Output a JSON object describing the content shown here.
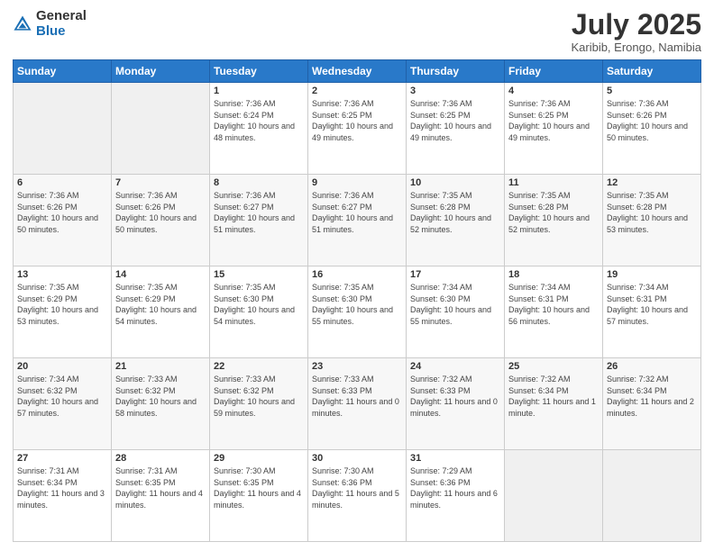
{
  "logo": {
    "general": "General",
    "blue": "Blue"
  },
  "title": "July 2025",
  "subtitle": "Karibib, Erongo, Namibia",
  "days_of_week": [
    "Sunday",
    "Monday",
    "Tuesday",
    "Wednesday",
    "Thursday",
    "Friday",
    "Saturday"
  ],
  "weeks": [
    [
      {
        "day": "",
        "info": ""
      },
      {
        "day": "",
        "info": ""
      },
      {
        "day": "1",
        "info": "Sunrise: 7:36 AM\nSunset: 6:24 PM\nDaylight: 10 hours and 48 minutes."
      },
      {
        "day": "2",
        "info": "Sunrise: 7:36 AM\nSunset: 6:25 PM\nDaylight: 10 hours and 49 minutes."
      },
      {
        "day": "3",
        "info": "Sunrise: 7:36 AM\nSunset: 6:25 PM\nDaylight: 10 hours and 49 minutes."
      },
      {
        "day": "4",
        "info": "Sunrise: 7:36 AM\nSunset: 6:25 PM\nDaylight: 10 hours and 49 minutes."
      },
      {
        "day": "5",
        "info": "Sunrise: 7:36 AM\nSunset: 6:26 PM\nDaylight: 10 hours and 50 minutes."
      }
    ],
    [
      {
        "day": "6",
        "info": "Sunrise: 7:36 AM\nSunset: 6:26 PM\nDaylight: 10 hours and 50 minutes."
      },
      {
        "day": "7",
        "info": "Sunrise: 7:36 AM\nSunset: 6:26 PM\nDaylight: 10 hours and 50 minutes."
      },
      {
        "day": "8",
        "info": "Sunrise: 7:36 AM\nSunset: 6:27 PM\nDaylight: 10 hours and 51 minutes."
      },
      {
        "day": "9",
        "info": "Sunrise: 7:36 AM\nSunset: 6:27 PM\nDaylight: 10 hours and 51 minutes."
      },
      {
        "day": "10",
        "info": "Sunrise: 7:35 AM\nSunset: 6:28 PM\nDaylight: 10 hours and 52 minutes."
      },
      {
        "day": "11",
        "info": "Sunrise: 7:35 AM\nSunset: 6:28 PM\nDaylight: 10 hours and 52 minutes."
      },
      {
        "day": "12",
        "info": "Sunrise: 7:35 AM\nSunset: 6:28 PM\nDaylight: 10 hours and 53 minutes."
      }
    ],
    [
      {
        "day": "13",
        "info": "Sunrise: 7:35 AM\nSunset: 6:29 PM\nDaylight: 10 hours and 53 minutes."
      },
      {
        "day": "14",
        "info": "Sunrise: 7:35 AM\nSunset: 6:29 PM\nDaylight: 10 hours and 54 minutes."
      },
      {
        "day": "15",
        "info": "Sunrise: 7:35 AM\nSunset: 6:30 PM\nDaylight: 10 hours and 54 minutes."
      },
      {
        "day": "16",
        "info": "Sunrise: 7:35 AM\nSunset: 6:30 PM\nDaylight: 10 hours and 55 minutes."
      },
      {
        "day": "17",
        "info": "Sunrise: 7:34 AM\nSunset: 6:30 PM\nDaylight: 10 hours and 55 minutes."
      },
      {
        "day": "18",
        "info": "Sunrise: 7:34 AM\nSunset: 6:31 PM\nDaylight: 10 hours and 56 minutes."
      },
      {
        "day": "19",
        "info": "Sunrise: 7:34 AM\nSunset: 6:31 PM\nDaylight: 10 hours and 57 minutes."
      }
    ],
    [
      {
        "day": "20",
        "info": "Sunrise: 7:34 AM\nSunset: 6:32 PM\nDaylight: 10 hours and 57 minutes."
      },
      {
        "day": "21",
        "info": "Sunrise: 7:33 AM\nSunset: 6:32 PM\nDaylight: 10 hours and 58 minutes."
      },
      {
        "day": "22",
        "info": "Sunrise: 7:33 AM\nSunset: 6:32 PM\nDaylight: 10 hours and 59 minutes."
      },
      {
        "day": "23",
        "info": "Sunrise: 7:33 AM\nSunset: 6:33 PM\nDaylight: 11 hours and 0 minutes."
      },
      {
        "day": "24",
        "info": "Sunrise: 7:32 AM\nSunset: 6:33 PM\nDaylight: 11 hours and 0 minutes."
      },
      {
        "day": "25",
        "info": "Sunrise: 7:32 AM\nSunset: 6:34 PM\nDaylight: 11 hours and 1 minute."
      },
      {
        "day": "26",
        "info": "Sunrise: 7:32 AM\nSunset: 6:34 PM\nDaylight: 11 hours and 2 minutes."
      }
    ],
    [
      {
        "day": "27",
        "info": "Sunrise: 7:31 AM\nSunset: 6:34 PM\nDaylight: 11 hours and 3 minutes."
      },
      {
        "day": "28",
        "info": "Sunrise: 7:31 AM\nSunset: 6:35 PM\nDaylight: 11 hours and 4 minutes."
      },
      {
        "day": "29",
        "info": "Sunrise: 7:30 AM\nSunset: 6:35 PM\nDaylight: 11 hours and 4 minutes."
      },
      {
        "day": "30",
        "info": "Sunrise: 7:30 AM\nSunset: 6:36 PM\nDaylight: 11 hours and 5 minutes."
      },
      {
        "day": "31",
        "info": "Sunrise: 7:29 AM\nSunset: 6:36 PM\nDaylight: 11 hours and 6 minutes."
      },
      {
        "day": "",
        "info": ""
      },
      {
        "day": "",
        "info": ""
      }
    ]
  ]
}
